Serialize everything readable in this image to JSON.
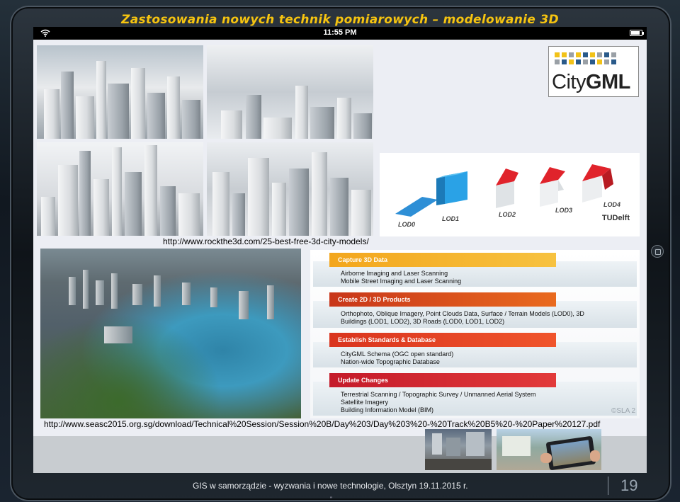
{
  "slide": {
    "title": "Zastosowania nowych technik pomiarowych – modelowanie 3D",
    "footer": "GIS w samorządzie - wyzwania i nowe technologie, Olsztyn 19.11.2015 r.",
    "footer_quote": "\"",
    "page_number": "19"
  },
  "status_bar": {
    "time": "11:55 PM",
    "wifi_icon": "wifi-icon",
    "battery_icon": "battery-icon"
  },
  "content": {
    "source_link_1": "http://www.rockthe3d.com/25-best-free-3d-city-models/",
    "source_link_2": "http://www.seasc2015.org.sg/download/Technical%20Session/Session%20B/Day%203/Day%203%20-%20Track%20B5%20-%20Paper%20127.pdf",
    "citygml_logo": {
      "text_light": "City",
      "text_bold": "GML"
    },
    "lod_labels": [
      "LOD0",
      "LOD1",
      "LOD2",
      "LOD3",
      "LOD4"
    ],
    "tudelft_label": "TUDelft",
    "watermark": "©SLA 2",
    "workflow": [
      {
        "heading": "Capture 3D Data",
        "items": [
          "Airborne Imaging and Laser Scanning",
          "Mobile Street Imaging and Laser Scanning"
        ]
      },
      {
        "heading": "Create 2D / 3D Products",
        "items": [
          "Orthophoto, Oblique Imagery, Point Clouds Data, Surface / Terrain Models (LOD0), 3D",
          "Buildings (LOD1, LOD2), 3D Roads (LOD0, LOD1, LOD2)"
        ]
      },
      {
        "heading": "Establish Standards & Database",
        "items": [
          "CityGML Schema (OGC open standard)",
          "Nation-wide Topographic Database"
        ]
      },
      {
        "heading": "Update Changes",
        "items": [
          "Terrestrial Scanning / Topographic Survey / Unmanned Aerial System",
          "Satellite Imagery",
          "Building Information Model (BIM)"
        ]
      }
    ],
    "colors": {
      "title": "#f6c410",
      "workflow_header": "#d1411f",
      "workflow_header_first": "#f0a020",
      "lod_roof": "#e0232b",
      "lod1": "#1f9ee0",
      "lod0": "#2e8fd6"
    }
  }
}
